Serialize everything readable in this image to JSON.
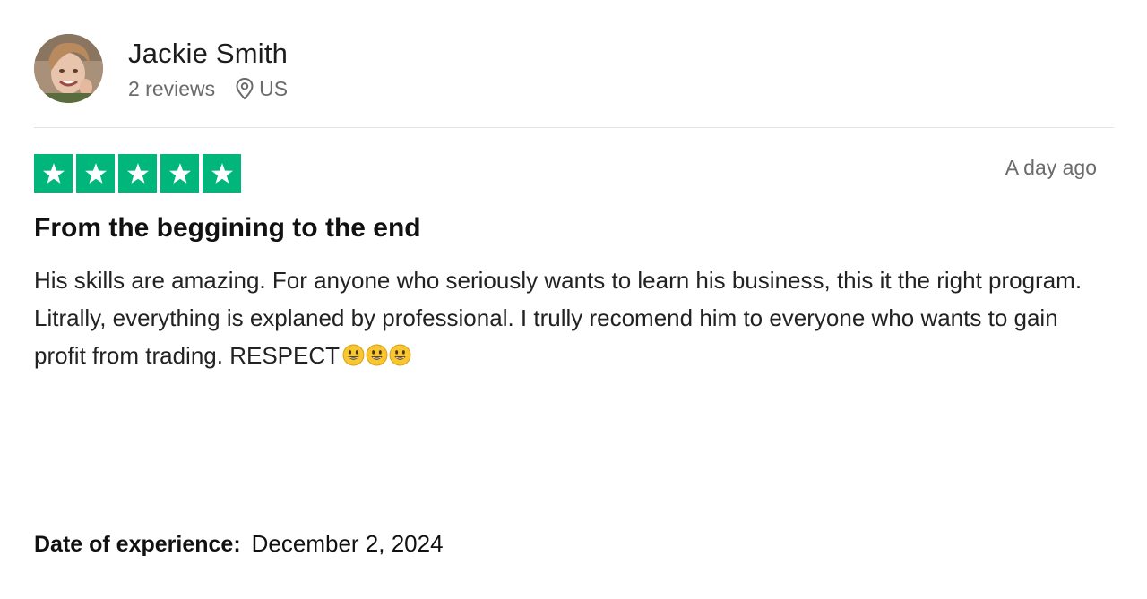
{
  "reviewer": {
    "name": "Jackie Smith",
    "reviews_count": "2 reviews",
    "country": "US",
    "avatar_icon": "user-photo"
  },
  "rating": {
    "stars": 5,
    "max_stars": 5,
    "star_color": "#00b67a",
    "star_icon": "star-icon"
  },
  "review": {
    "time_ago": "A day ago",
    "title": "From the beggining to the end",
    "body": "His skills are amazing. For anyone who seriously wants to learn his business, this it the right program. Litrally, everything is explaned by professional. I trully recomend him to everyone who wants to gain profit from trading. RESPECT",
    "emojis": [
      "smiley-emoji",
      "smiley-emoji",
      "smiley-emoji"
    ]
  },
  "experience": {
    "label": "Date of experience:",
    "date": "December 2, 2024"
  },
  "colors": {
    "text": "#1a1a1a",
    "muted": "#6b6b6b",
    "divider": "#e3e3e3",
    "trustpilot_green": "#00b67a"
  }
}
